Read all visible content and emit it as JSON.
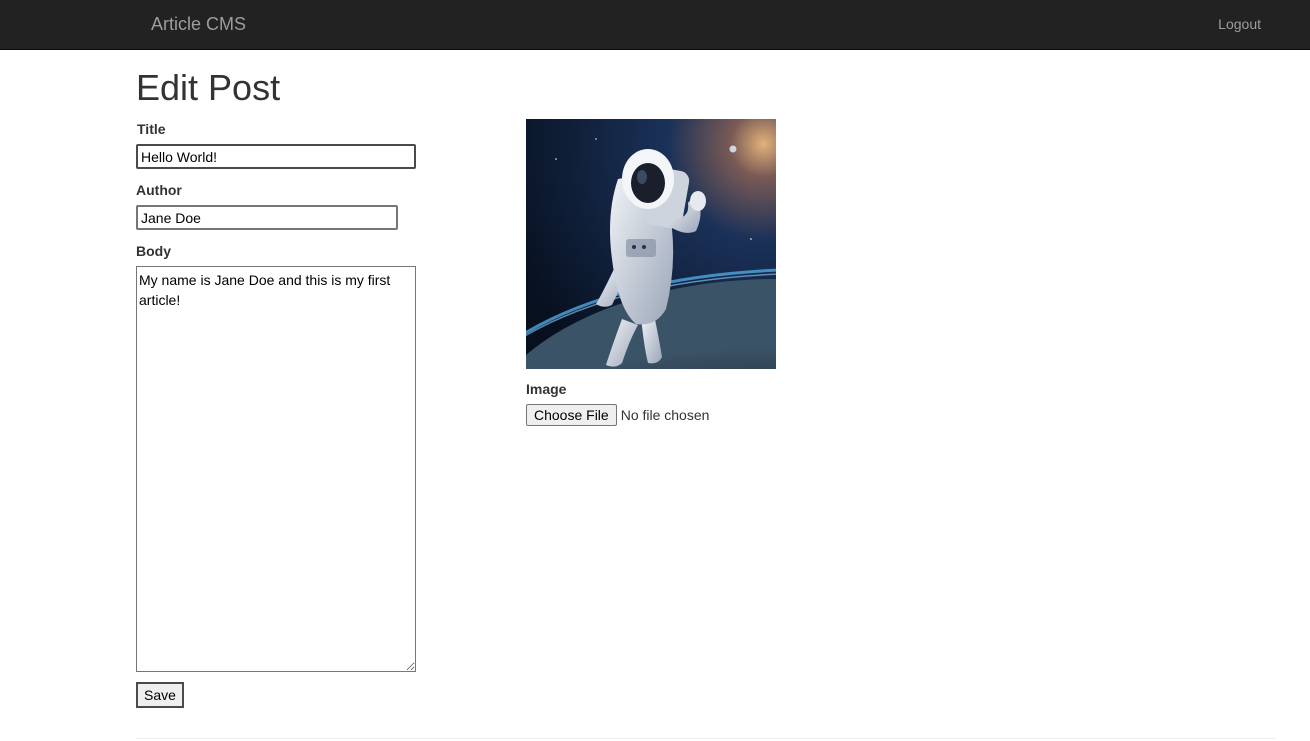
{
  "navbar": {
    "brand": "Article CMS",
    "logout": "Logout"
  },
  "page": {
    "title": "Edit Post"
  },
  "form": {
    "title_label": "Title",
    "title_value": "Hello World!",
    "author_label": "Author",
    "author_value": "Jane Doe",
    "body_label": "Body",
    "body_value": "My name is Jane Doe and this is my first article!",
    "save_label": "Save",
    "image_label": "Image",
    "file_button_label": "Choose File",
    "file_status": "No file chosen"
  },
  "image": {
    "icon": "astronaut-image"
  },
  "colors": {
    "navbar_bg": "#222222",
    "navbar_text": "#9d9d9d"
  }
}
